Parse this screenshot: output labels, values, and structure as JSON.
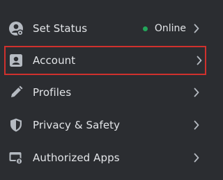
{
  "colors": {
    "background": "#2b2d31",
    "text": "#e3e5e8",
    "icon": "#b5bac1",
    "online": "#23a55a",
    "highlight_border": "#d0312d"
  },
  "menu": {
    "items": [
      {
        "label": "Set Status",
        "icon": "user-status-icon",
        "status": "Online",
        "status_icon": "online-dot-icon"
      },
      {
        "label": "Account",
        "icon": "account-card-icon",
        "highlighted": true
      },
      {
        "label": "Profiles",
        "icon": "pencil-icon"
      },
      {
        "label": "Privacy & Safety",
        "icon": "shield-icon"
      },
      {
        "label": "Authorized Apps",
        "icon": "authorized-apps-icon"
      }
    ]
  }
}
